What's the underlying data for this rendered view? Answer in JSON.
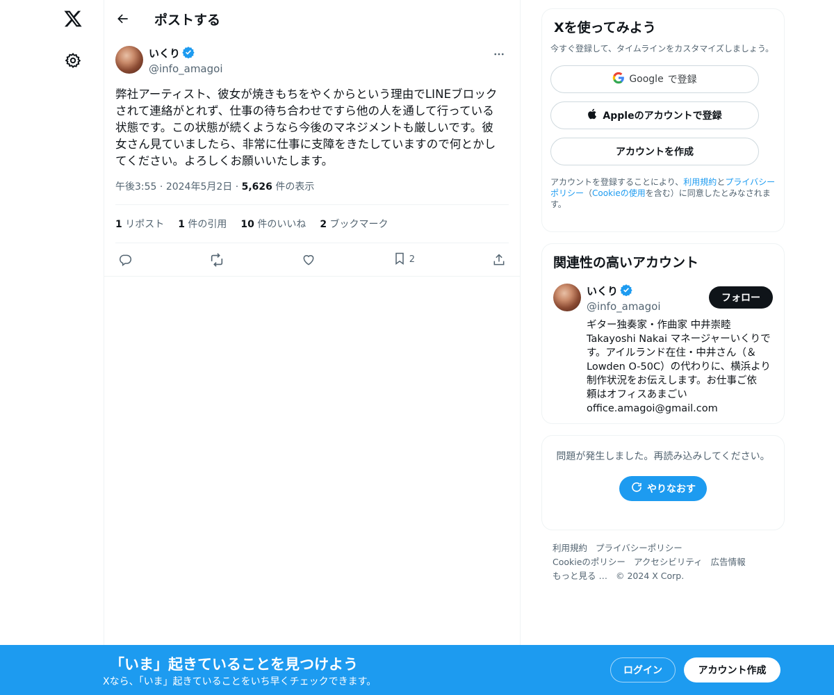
{
  "nav": {
    "logo_icon": "x-logo-icon",
    "settings_icon": "gear-icon"
  },
  "header": {
    "title": "ポストする"
  },
  "post": {
    "author_name": "いくり",
    "author_handle": "@info_amagoi",
    "text": "弊社アーティスト、彼女が焼きもちをやくからという理由でLINEブロック\nされて連絡がとれず、仕事の待ち合わせですら他の人を通して行っている\n状態です。この状態が続くようなら今後のマネジメントも厳しいです。彼\n女さん見ていましたら、非常に仕事に支障をきたしていますので何とかし\nてください。よろしくお願いいたします。",
    "time": "午後3:55",
    "date": "2024年5月2日",
    "views_count": "5,626",
    "views_label": "件の表示",
    "stats": {
      "reposts_count": "1",
      "reposts_label": "リポスト",
      "quotes_count": "1",
      "quotes_label": "件の引用",
      "likes_count": "10",
      "likes_label": "件のいいね",
      "bookmarks_count": "2",
      "bookmarks_label": "ブックマーク"
    },
    "actions": {
      "bookmark_count": "2"
    }
  },
  "signup_card": {
    "title": "Xを使ってみよう",
    "subtitle": "今すぐ登録して、タイムラインをカスタマイズしましょう。",
    "google_brand": "Google",
    "google_label": "で登録",
    "apple_label": "Appleのアカウントで登録",
    "create_label": "アカウントを作成",
    "legal_1": "アカウントを登録することにより、",
    "legal_terms": "利用規約",
    "legal_and": "と",
    "legal_privacy": "プライバシーポリシー",
    "legal_2": "（",
    "legal_cookie": "Cookieの使用",
    "legal_3": "を含む）に同意したとみなされます。"
  },
  "related": {
    "title": "関連性の高いアカウント",
    "name": "いくり",
    "handle": "@info_amagoi",
    "follow_label": "フォロー",
    "bio": "ギター独奏家・作曲家 中井崇睦\nTakayoshi Nakai マネージャーいくりで\nす。アイルランド在住・中井さん（＆\nLowden O-50C）の代わりに、横浜より\n制作状況をお伝えします。お仕事ご依\n頼はオフィスあまごい\noffice.amagoi@gmail.com"
  },
  "error_card": {
    "message": "問題が発生しました。再読み込みしてください。",
    "retry_label": "やりなおす"
  },
  "footer": {
    "terms": "利用規約",
    "privacy": "プライバシーポリシー",
    "cookie": "Cookieのポリシー",
    "accessibility": "アクセシビリティ",
    "ads": "広告情報",
    "more": "もっと見る …",
    "copyright": "© 2024 X Corp."
  },
  "banner": {
    "title": "「いま」起きていることを見つけよう",
    "subtitle": "Xなら、「いま」起きていることをいち早くチェックできます。",
    "login_label": "ログイン",
    "signup_label": "アカウント作成"
  },
  "colors": {
    "accent": "#1d9bf0",
    "text": "#0f1419",
    "muted": "#536471",
    "border": "#eff3f4"
  }
}
